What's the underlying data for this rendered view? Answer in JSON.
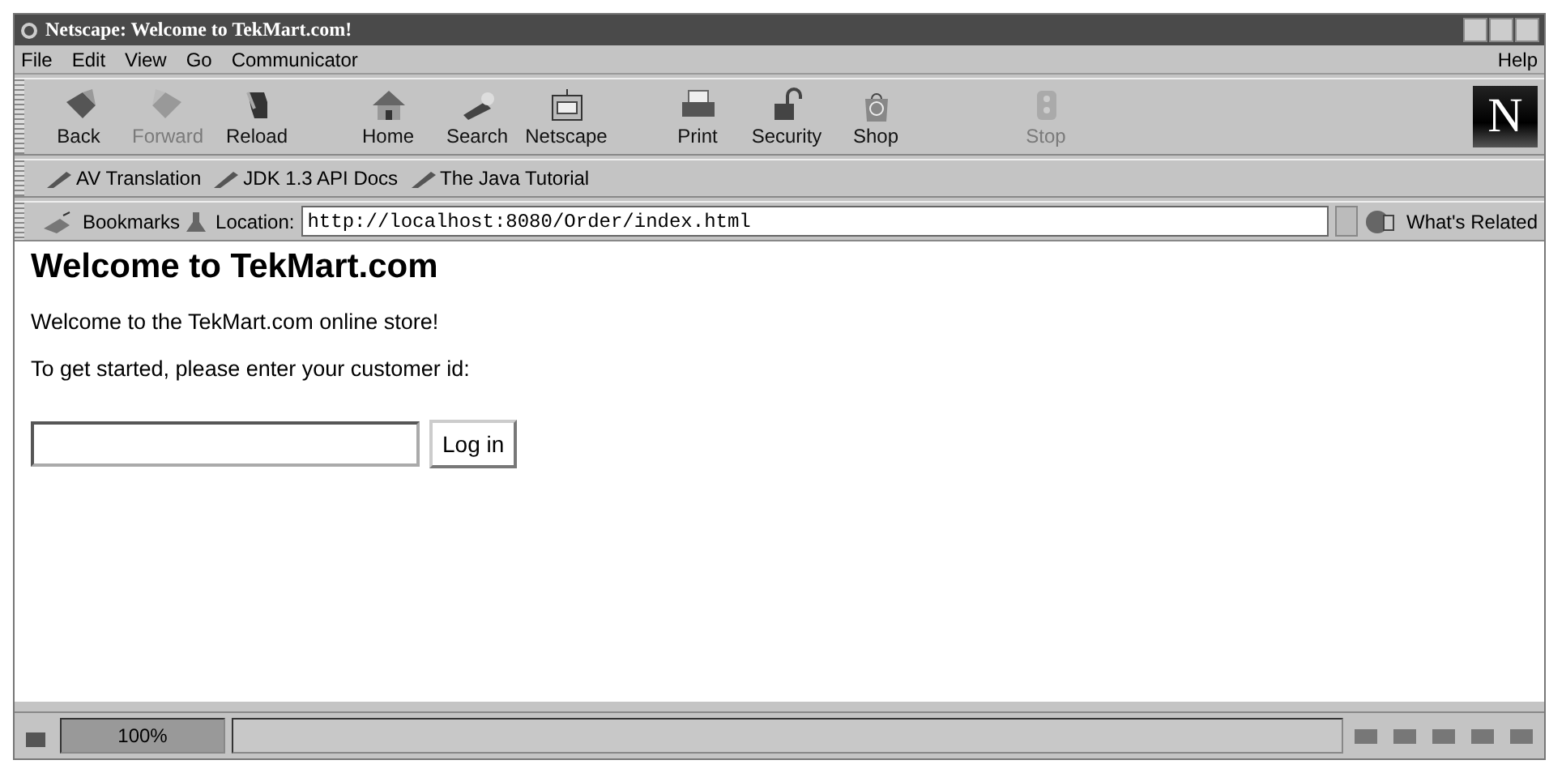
{
  "window": {
    "title": "Netscape: Welcome to TekMart.com!"
  },
  "menu": {
    "left": [
      "File",
      "Edit",
      "View",
      "Go",
      "Communicator"
    ],
    "right": "Help"
  },
  "toolbar": [
    {
      "label": "Back",
      "kind": "back",
      "disabled": false
    },
    {
      "label": "Forward",
      "kind": "forward",
      "disabled": true
    },
    {
      "label": "Reload",
      "kind": "reload",
      "disabled": false
    },
    {
      "label": "Home",
      "kind": "home",
      "disabled": false
    },
    {
      "label": "Search",
      "kind": "search",
      "disabled": false
    },
    {
      "label": "Netscape",
      "kind": "netscape",
      "disabled": false
    },
    {
      "label": "Print",
      "kind": "print",
      "disabled": false
    },
    {
      "label": "Security",
      "kind": "security",
      "disabled": false
    },
    {
      "label": "Shop",
      "kind": "shop",
      "disabled": false
    },
    {
      "label": "Stop",
      "kind": "stop",
      "disabled": true
    }
  ],
  "logo": "N",
  "personal_toolbar": [
    "AV Translation",
    "JDK 1.3 API Docs",
    "The Java Tutorial"
  ],
  "location_bar": {
    "bookmarks": "Bookmarks",
    "label": "Location:",
    "url": "http://localhost:8080/Order/index.html",
    "related": "What's Related"
  },
  "page": {
    "heading": "Welcome to TekMart.com",
    "paragraphs": [
      "Welcome to the TekMart.com online store!",
      "To get started, please enter your customer id:"
    ],
    "button": "Log in"
  },
  "status_bar": {
    "progress": "100%",
    "level": 1
  }
}
